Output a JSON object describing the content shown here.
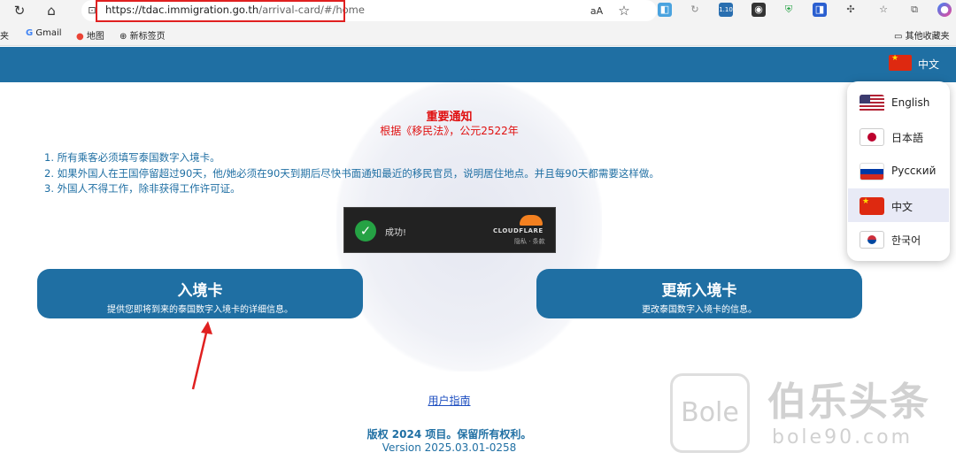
{
  "browser": {
    "url_host": "https://tdac.immigration.go.th",
    "url_path": "/arrival-card/#/home",
    "extension_badge": "1.10"
  },
  "bookmarks": {
    "gmail": "Gmail",
    "maps": "地图",
    "new_tab": "新标签页",
    "other": "其他收藏夹"
  },
  "header": {
    "current_language": "中文"
  },
  "notice": {
    "title": "重要通知",
    "subtitle": "根据《移民法》，公元2522年",
    "items": [
      "1. 所有乘客必须填写泰国数字入境卡。",
      "2. 如果外国人在王国停留超过90天，他/她必须在90天到期后尽快书面通知最近的移民官员，说明居住地点。并且每90天都需要这样做。",
      "3. 外国人不得工作，除非获得工作许可证。"
    ]
  },
  "captcha": {
    "status": "成功!",
    "brand": "CLOUDFLARE",
    "links": "隐私 · 条款"
  },
  "buttons": {
    "arrival_title": "入境卡",
    "arrival_sub": "提供您即将到来的泰国数字入境卡的详细信息。",
    "update_title": "更新入境卡",
    "update_sub": "更改泰国数字入境卡的信息。"
  },
  "languages": [
    {
      "name": "English",
      "flag": "us-flag"
    },
    {
      "name": "日本語",
      "flag": "jp-flag"
    },
    {
      "name": "Русский",
      "flag": "ru-flag"
    },
    {
      "name": "中文",
      "flag": "cn-flag",
      "selected": true
    },
    {
      "name": "한국어",
      "flag": "kr-flag"
    }
  ],
  "footer": {
    "guide": "用户指南",
    "copyright": "版权 2024 项目。保留所有权利。",
    "version": "Version 2025.03.01-0258"
  },
  "watermark": {
    "big": "伯乐头条",
    "small": "bole90.com",
    "logo": "Bole"
  },
  "colors": {
    "primary": "#1f6fa3",
    "notice_red": "#e01010",
    "highlight_red": "#e02020"
  }
}
